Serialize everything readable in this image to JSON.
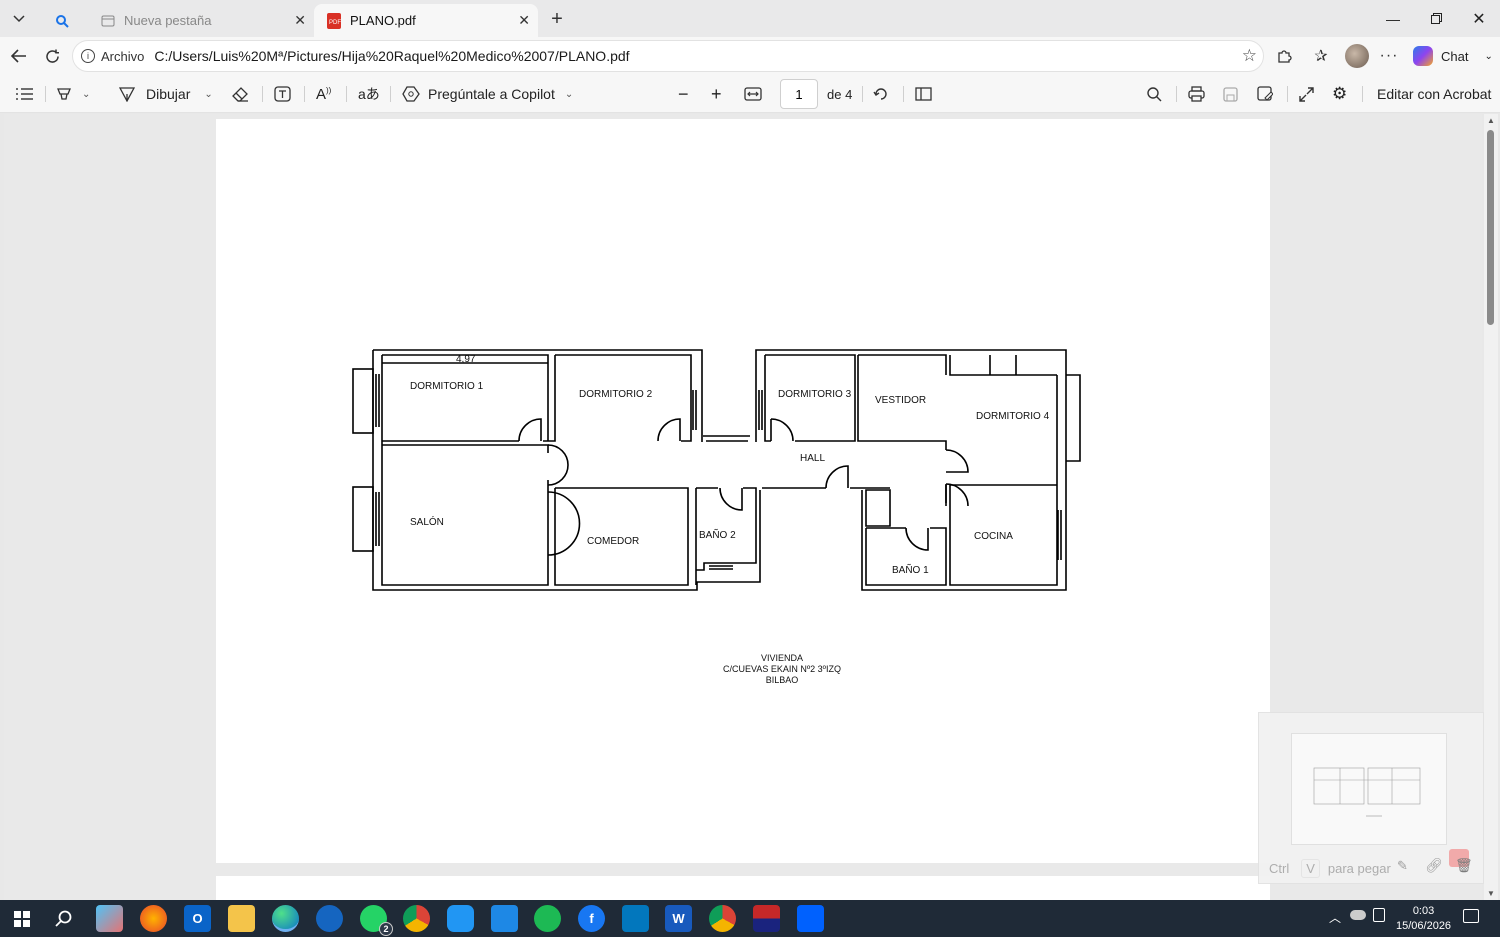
{
  "tabs": [
    {
      "label": "",
      "icon": "search-icon"
    },
    {
      "label": "Nueva pestaña",
      "icon": "new-tab-icon"
    },
    {
      "label": "PLANO.pdf",
      "icon": "pdf-icon"
    }
  ],
  "address": {
    "prefix": "Archivo",
    "url": "C:/Users/Luis%20Mª/Pictures/Hija%20Raquel%20Medico%2007/PLANO.pdf"
  },
  "browser": {
    "chat_label": "Chat"
  },
  "pdf_toolbar": {
    "draw_label": "Dibujar",
    "copilot_label": "Pregúntale a Copilot",
    "page_current": "1",
    "page_total": "de 4",
    "edit_acrobat": "Editar con Acrobat"
  },
  "plan": {
    "dimension": "4,97",
    "rooms": {
      "dormitorio1": "DORMITORIO 1",
      "dormitorio2": "DORMITORIO 2",
      "dormitorio3": "DORMITORIO 3",
      "vestidor": "VESTIDOR",
      "dormitorio4": "DORMITORIO 4",
      "hall": "HALL",
      "salon": "SALÓN",
      "comedor": "COMEDOR",
      "bano2": "BAÑO 2",
      "bano1": "BAÑO 1",
      "cocina": "COCINA"
    },
    "caption": [
      "VIVIENDA",
      "C/CUEVAS EKAIN Nº2 3ºIZQ",
      "BILBAO"
    ]
  },
  "paste_panel": {
    "key1": "Ctrl",
    "key2": "V",
    "hint": "para pegar"
  },
  "taskbar": {
    "time": "0:03",
    "date": "15/06/2026",
    "whatsapp_badge": "2"
  }
}
